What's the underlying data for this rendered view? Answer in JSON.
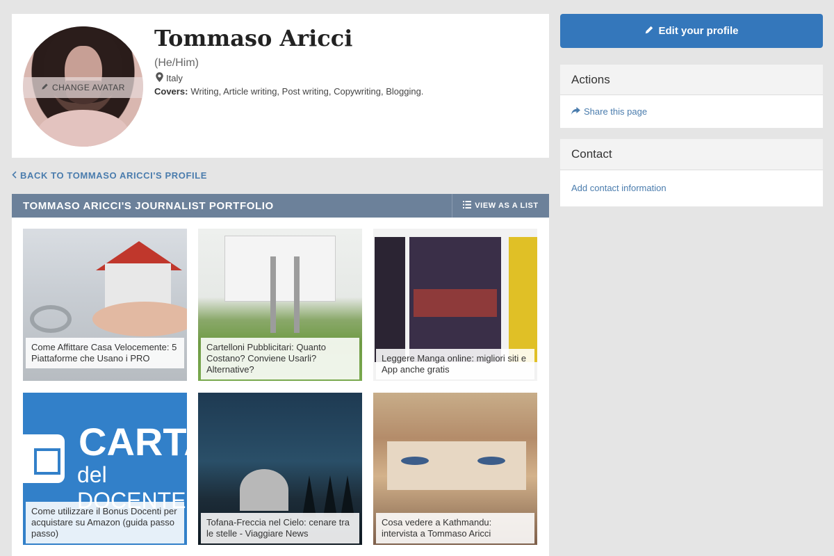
{
  "profile": {
    "name": "Tommaso Aricci",
    "pronouns": "(He/Him)",
    "location": "Italy",
    "covers_label": "Covers:",
    "covers_value": "Writing, Article writing, Post writing, Copywriting, Blogging.",
    "change_avatar_label": "CHANGE AVATAR"
  },
  "back_link": {
    "label": "BACK TO TOMMASO ARICCI'S PROFILE"
  },
  "portfolio": {
    "title": "TOMMASO ARICCI'S JOURNALIST PORTFOLIO",
    "view_list_label": "VIEW AS A LIST",
    "items": [
      {
        "title": "Come Affittare Casa Velocemente: 5 Piattaforme che Usano i PRO"
      },
      {
        "title": "Cartelloni Pubblicitari: Quanto Costano? Conviene Usarli? Alternative?"
      },
      {
        "title": "Leggere Manga online: migliori siti e App anche gratis"
      },
      {
        "title": "Come utilizzare il Bonus Docenti per acquistare su Amazon (guida passo passo)"
      },
      {
        "title": "Tofana-Freccia nel Cielo: cenare tra le stelle - Viaggiare News"
      },
      {
        "title": "Cosa vedere a Kathmandu: intervista a Tommaso Aricci"
      }
    ],
    "tile4_text1": "CARTA",
    "tile4_text2": "del DOCENTE"
  },
  "sidebar": {
    "edit_profile_label": "Edit your profile",
    "actions_title": "Actions",
    "share_label": "Share this page",
    "contact_title": "Contact",
    "add_contact_label": "Add contact information"
  },
  "colors": {
    "primary": "#3477bb",
    "header": "#6c819a",
    "link": "#4a7cad"
  }
}
